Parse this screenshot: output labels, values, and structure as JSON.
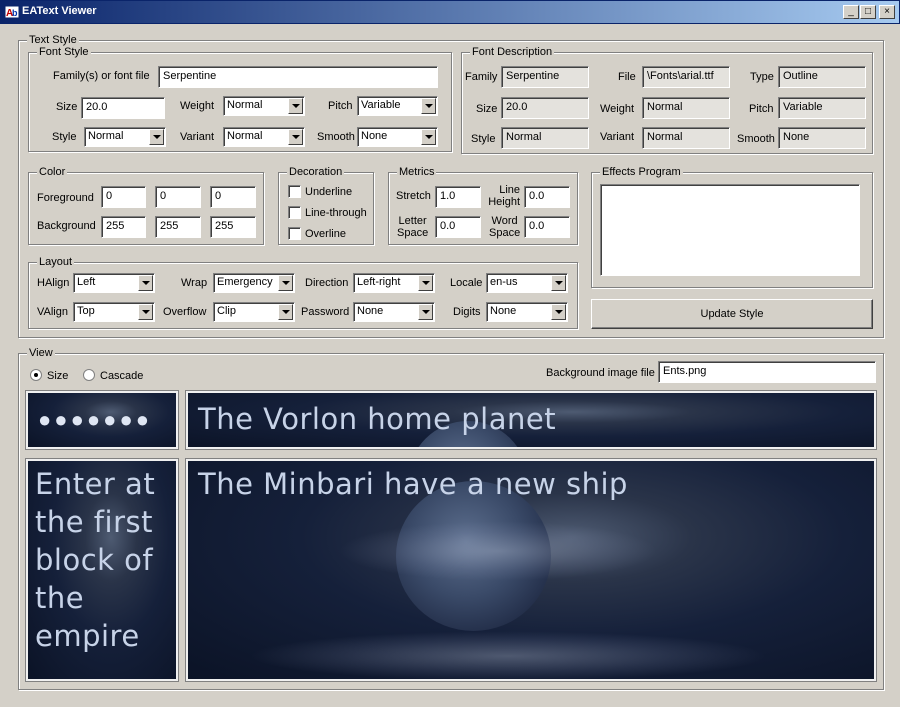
{
  "window": {
    "title": "EAText Viewer",
    "minimize": "_",
    "maximize": "□",
    "close": "×"
  },
  "text_style": {
    "label": "Text Style",
    "font_style": {
      "label": "Font Style",
      "family_label": "Family(s) or font file",
      "family_value": "Serpentine",
      "size_label": "Size",
      "size_value": "20.0",
      "weight_label": "Weight",
      "weight_value": "Normal",
      "pitch_label": "Pitch",
      "pitch_value": "Variable",
      "style_label": "Style",
      "style_value": "Normal",
      "variant_label": "Variant",
      "variant_value": "Normal",
      "smooth_label": "Smooth",
      "smooth_value": "None"
    },
    "font_description": {
      "label": "Font Description",
      "family_label": "Family",
      "family_value": "Serpentine",
      "file_label": "File",
      "file_value": "\\Fonts\\arial.ttf",
      "type_label": "Type",
      "type_value": "Outline",
      "size_label": "Size",
      "size_value": "20.0",
      "weight_label": "Weight",
      "weight_value": "Normal",
      "pitch_label": "Pitch",
      "pitch_value": "Variable",
      "style_label": "Style",
      "style_value": "Normal",
      "variant_label": "Variant",
      "variant_value": "Normal",
      "smooth_label": "Smooth",
      "smooth_value": "None"
    },
    "color": {
      "label": "Color",
      "foreground_label": "Foreground",
      "foreground": [
        "0",
        "0",
        "0"
      ],
      "background_label": "Background",
      "background": [
        "255",
        "255",
        "255"
      ]
    },
    "decoration": {
      "label": "Decoration",
      "underline": "Underline",
      "line_through": "Line-through",
      "overline": "Overline"
    },
    "metrics": {
      "label": "Metrics",
      "stretch_label": "Stretch",
      "stretch_value": "1.0",
      "line_height_label_1": "Line",
      "line_height_label_2": "Height",
      "line_height_value": "0.0",
      "letter_space_label_1": "Letter",
      "letter_space_label_2": "Space",
      "letter_space_value": "0.0",
      "word_space_label_1": "Word",
      "word_space_label_2": "Space",
      "word_space_value": "0.0"
    },
    "effects": {
      "label": "Effects Program",
      "value": ""
    },
    "layout": {
      "label": "Layout",
      "halign_label": "HAlign",
      "halign_value": "Left",
      "wrap_label": "Wrap",
      "wrap_value": "Emergency",
      "direction_label": "Direction",
      "direction_value": "Left-right",
      "locale_label": "Locale",
      "locale_value": "en-us",
      "valign_label": "VAlign",
      "valign_value": "Top",
      "overflow_label": "Overflow",
      "overflow_value": "Clip",
      "password_label": "Password",
      "password_value": "None",
      "digits_label": "Digits",
      "digits_value": "None"
    },
    "update_button": "Update Style"
  },
  "view": {
    "label": "View",
    "radio_size": "Size",
    "radio_cascade": "Cascade",
    "bg_image_label": "Background image file",
    "bg_image_value": "Ents.png",
    "password_dots": "●●●●●●●",
    "top_text": "The Vorlon home planet",
    "left_text": "Enter at the first block of the empire",
    "main_text": "The Minbari have a new ship"
  }
}
